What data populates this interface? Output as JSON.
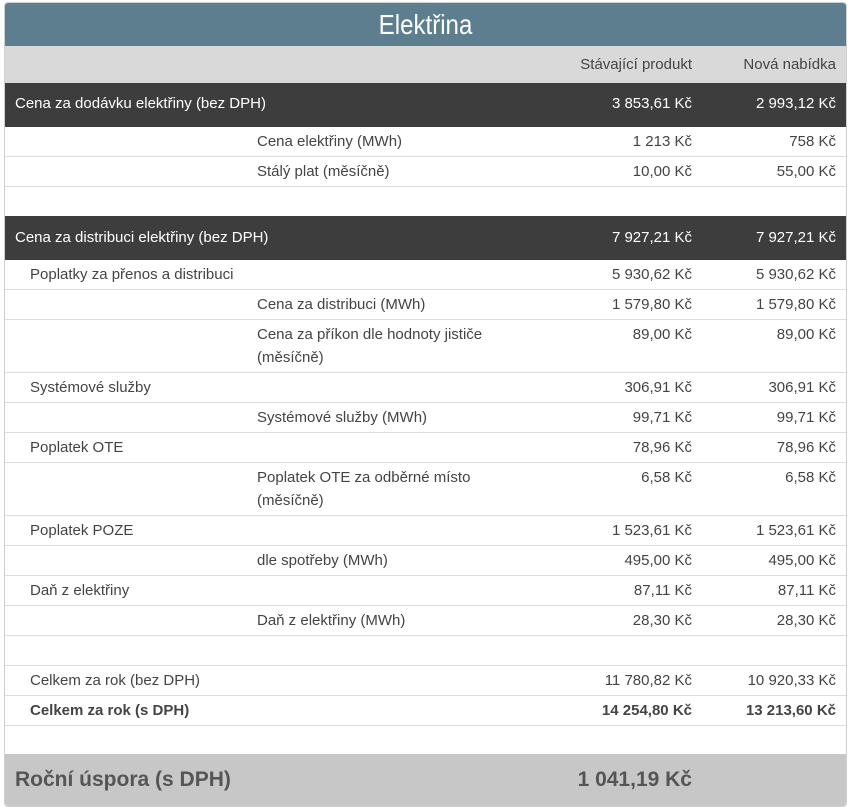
{
  "title": "Elektřina",
  "columns": {
    "current": "Stávající produkt",
    "new": "Nová nabídka"
  },
  "rows": [
    {
      "label": "Cena za dodávku elektřiny (bez DPH)",
      "current": "3 853,61 Kč",
      "new": "2 993,12 Kč"
    },
    {
      "label": "Cena elektřiny (MWh)",
      "current": "1 213 Kč",
      "new": "758 Kč"
    },
    {
      "label": "Stálý plat (měsíčně)",
      "current": "10,00 Kč",
      "new": "55,00 Kč"
    },
    {
      "label": "Cena za distribuci elektřiny (bez DPH)",
      "current": "7 927,21 Kč",
      "new": "7 927,21 Kč"
    },
    {
      "label": "Poplatky za přenos a distribuci",
      "current": "5 930,62 Kč",
      "new": "5 930,62 Kč"
    },
    {
      "label": "Cena za distribuci (MWh)",
      "current": "1 579,80 Kč",
      "new": "1 579,80 Kč"
    },
    {
      "label": "Cena za příkon dle hodnoty jističe",
      "label2": "(měsíčně)",
      "current": "89,00 Kč",
      "new": "89,00 Kč"
    },
    {
      "label": "Systémové služby",
      "current": "306,91 Kč",
      "new": "306,91 Kč"
    },
    {
      "label": "Systémové služby (MWh)",
      "current": "99,71 Kč",
      "new": "99,71 Kč"
    },
    {
      "label": "Poplatek OTE",
      "current": "78,96 Kč",
      "new": "78,96 Kč"
    },
    {
      "label": "Poplatek OTE za odběrné místo",
      "label2": "(měsíčně)",
      "current": "6,58 Kč",
      "new": "6,58 Kč"
    },
    {
      "label": "Poplatek POZE",
      "current": "1 523,61 Kč",
      "new": "1 523,61 Kč"
    },
    {
      "label": "dle spotřeby (MWh)",
      "current": "495,00 Kč",
      "new": "495,00 Kč"
    },
    {
      "label": "Daň z elektřiny",
      "current": "87,11 Kč",
      "new": "87,11 Kč"
    },
    {
      "label": "Daň z elektřiny (MWh)",
      "current": "28,30 Kč",
      "new": "28,30 Kč"
    },
    {
      "label": "Celkem za rok (bez DPH)",
      "current": "11 780,82 Kč",
      "new": "10 920,33 Kč"
    },
    {
      "label": "Celkem za rok (s DPH)",
      "current": "14 254,80 Kč",
      "new": "13 213,60 Kč"
    }
  ],
  "savings": {
    "label": "Roční úspora (s DPH)",
    "value": "1 041,19 Kč"
  },
  "colors": {
    "header": "#5c7e8f",
    "dark_row": "#3d3d3d",
    "column_header": "#d9d9d9",
    "footer": "#c7c7c7"
  }
}
